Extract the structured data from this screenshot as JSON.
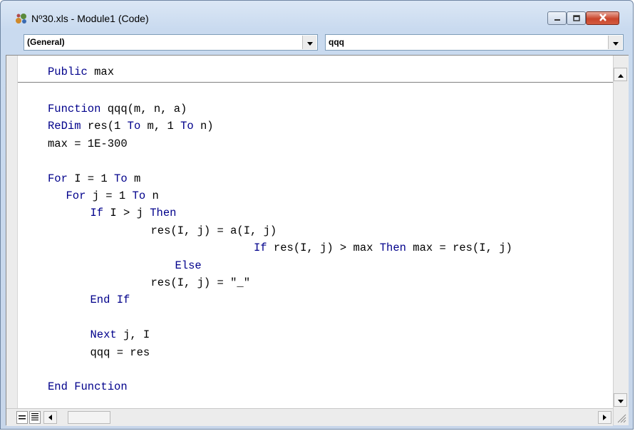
{
  "window": {
    "title": "Nº30.xls - Module1 (Code)"
  },
  "toolbar": {
    "object_combo": "(General)",
    "procedure_combo": "qqq"
  },
  "code": {
    "declaration": [
      {
        "parts": [
          {
            "t": "Public",
            "k": true
          },
          {
            "t": " max"
          }
        ]
      }
    ],
    "procedure": [
      {
        "parts": [
          {
            "t": "Function",
            "k": true
          },
          {
            "t": " qqq(m, n, a)"
          }
        ],
        "indent": 0,
        "row": 0
      },
      {
        "parts": [
          {
            "t": "ReDim",
            "k": true
          },
          {
            "t": " res(1 "
          },
          {
            "t": "To",
            "k": true
          },
          {
            "t": " m, 1 "
          },
          {
            "t": "To",
            "k": true
          },
          {
            "t": " n)"
          }
        ],
        "indent": 0,
        "row": 1
      },
      {
        "parts": [
          {
            "t": "max = 1E-300"
          }
        ],
        "indent": 0,
        "row": 2
      },
      {
        "parts": [
          {
            "t": "For",
            "k": true
          },
          {
            "t": " I = 1 "
          },
          {
            "t": "To",
            "k": true
          },
          {
            "t": " m"
          }
        ],
        "indent": 0,
        "row": 4
      },
      {
        "parts": [
          {
            "t": "For",
            "k": true
          },
          {
            "t": " j = 1 "
          },
          {
            "t": "To",
            "k": true
          },
          {
            "t": " n"
          }
        ],
        "indent": 3,
        "row": 5
      },
      {
        "parts": [
          {
            "t": "If",
            "k": true
          },
          {
            "t": " I > j "
          },
          {
            "t": "Then",
            "k": true
          }
        ],
        "indent": 7,
        "row": 6
      },
      {
        "parts": [
          {
            "t": "res(I, j) = a(I, j)"
          }
        ],
        "indent": 17,
        "row": 7
      },
      {
        "parts": [
          {
            "t": "If",
            "k": true
          },
          {
            "t": " res(I, j) > max "
          },
          {
            "t": "Then",
            "k": true
          },
          {
            "t": " max = res(I, j)"
          }
        ],
        "indent": 34,
        "row": 8
      },
      {
        "parts": [
          {
            "t": "Else",
            "k": true
          }
        ],
        "indent": 21,
        "row": 9
      },
      {
        "parts": [
          {
            "t": "res(I, j) = \"_\""
          }
        ],
        "indent": 17,
        "row": 10
      },
      {
        "parts": [
          {
            "t": "End If",
            "k": true
          }
        ],
        "indent": 7,
        "row": 11
      },
      {
        "parts": [
          {
            "t": "Next",
            "k": true
          },
          {
            "t": " j, I"
          }
        ],
        "indent": 7,
        "row": 13
      },
      {
        "parts": [
          {
            "t": "qqq = res"
          }
        ],
        "indent": 7,
        "row": 14
      },
      {
        "parts": [
          {
            "t": "End Function",
            "k": true
          }
        ],
        "indent": 0,
        "row": 16
      }
    ]
  },
  "colors": {
    "keyword": "#00008b",
    "text": "#000000",
    "close_button": "#c9452c"
  },
  "icons": [
    "vba-module-icon",
    "minimize-icon",
    "maximize-icon",
    "close-icon",
    "dropdown-arrow-icon",
    "scroll-up-icon",
    "scroll-down-icon",
    "scroll-left-icon",
    "scroll-right-icon",
    "procedure-view-icon",
    "full-module-view-icon",
    "resize-grip-icon"
  ]
}
